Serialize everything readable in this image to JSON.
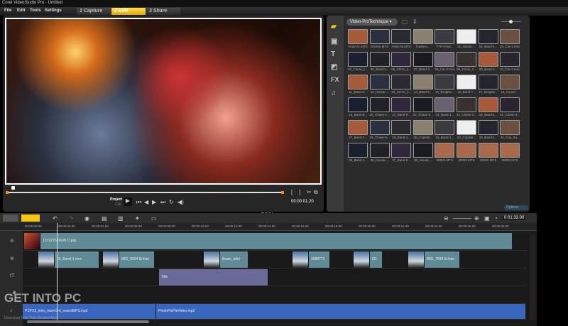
{
  "window": {
    "title": "Corel VideoStudio Pro - Untitled"
  },
  "menu": [
    "File",
    "Edit",
    "Tools",
    "Settings"
  ],
  "steps": [
    {
      "label": "1  Capture",
      "active": false
    },
    {
      "label": "2  Edit",
      "active": true
    },
    {
      "label": "3  Share",
      "active": false
    }
  ],
  "preview": {
    "mode_project": "Project",
    "mode_clip": "Clip",
    "timecode": "00:00:01.20",
    "scrub_position": 0.03
  },
  "library": {
    "folder": "Video-ProTechnique",
    "options": "Options",
    "side_icons": [
      "media-icon",
      "instant-project-icon",
      "title-icon",
      "transition-icon",
      "fx-icon",
      "audio-icon"
    ],
    "items": [
      "Andy-01.MTS",
      "Screen.MTS",
      "Andy-02.MTS",
      "fotolia-c...",
      "TTR-Final...",
      "01_House-...",
      "02_Band-1...",
      "03_Car-1.mov",
      "04_Crime_s...",
      "05_Band-2...",
      "06_Crime_s...",
      "07_Band-3...",
      "08_Car-2.mov",
      "09_Crime_s...",
      "09_Band-4...",
      "10_Car-3.mov",
      "11_Band-5...",
      "12_House-...",
      "13_Crime_s...",
      "14_Band-6...",
      "15_DrugDe...",
      "16_Band-7...",
      "17_DrugDe...",
      "18_House-...",
      "19_Band-8...",
      "20_Chase-1...",
      "21_Band-9...",
      "22_Chase-2...",
      "23_Band-1...",
      "24_Chase-3...",
      "25_Band-1...",
      "26_Chase-4...",
      "27_Band-1...",
      "28_Chase-5...",
      "29_Band-1...",
      "30_CopInB...",
      "31_Band-1...",
      "32_CopInB...",
      "33_Band-1...",
      "34_Cop_Su...",
      "35_Band-1...",
      "36_House-...",
      "37_Band-6...",
      "38_House-...",
      "00002.MTS",
      "00002.MTS",
      "00002.MTS",
      "00002.MTS"
    ]
  },
  "timeline": {
    "duration": "0:01:33.00",
    "ruler": [
      "00:00:00.00",
      "00:00:02.00",
      "00:00:04.00",
      "00:00:06.00",
      "00:00:08.00",
      "00:00:10.00",
      "00:00:12.00",
      "00:00:14.00",
      "00:00:16.00",
      "00:00:18.00",
      "00:00:20.00",
      "00:00:22.00",
      "00:00:24.00",
      "00:00:26.00",
      "00:00:28.00"
    ],
    "video_clip": "1372275416x677.jpg",
    "overlay_clips": [
      "02_Band-1.mov",
      "IMG_8394 Enhan",
      "Boats_after",
      "4088771",
      "I21",
      "IMG_7849 Enhan"
    ],
    "title_clip": "Title",
    "music_clips": [
      "PSPX3_intro_lower3rd_soundMP3.mp3",
      "PhotoPlePleVideo.mp3"
    ],
    "colors": {
      "video": "#5f8a96",
      "title": "#6a6a9a",
      "music": "#3a66c0",
      "accent": "#f5c518"
    }
  },
  "watermark": {
    "main": "GET INTO PC",
    "sub": "Download Free Your Desired App"
  }
}
